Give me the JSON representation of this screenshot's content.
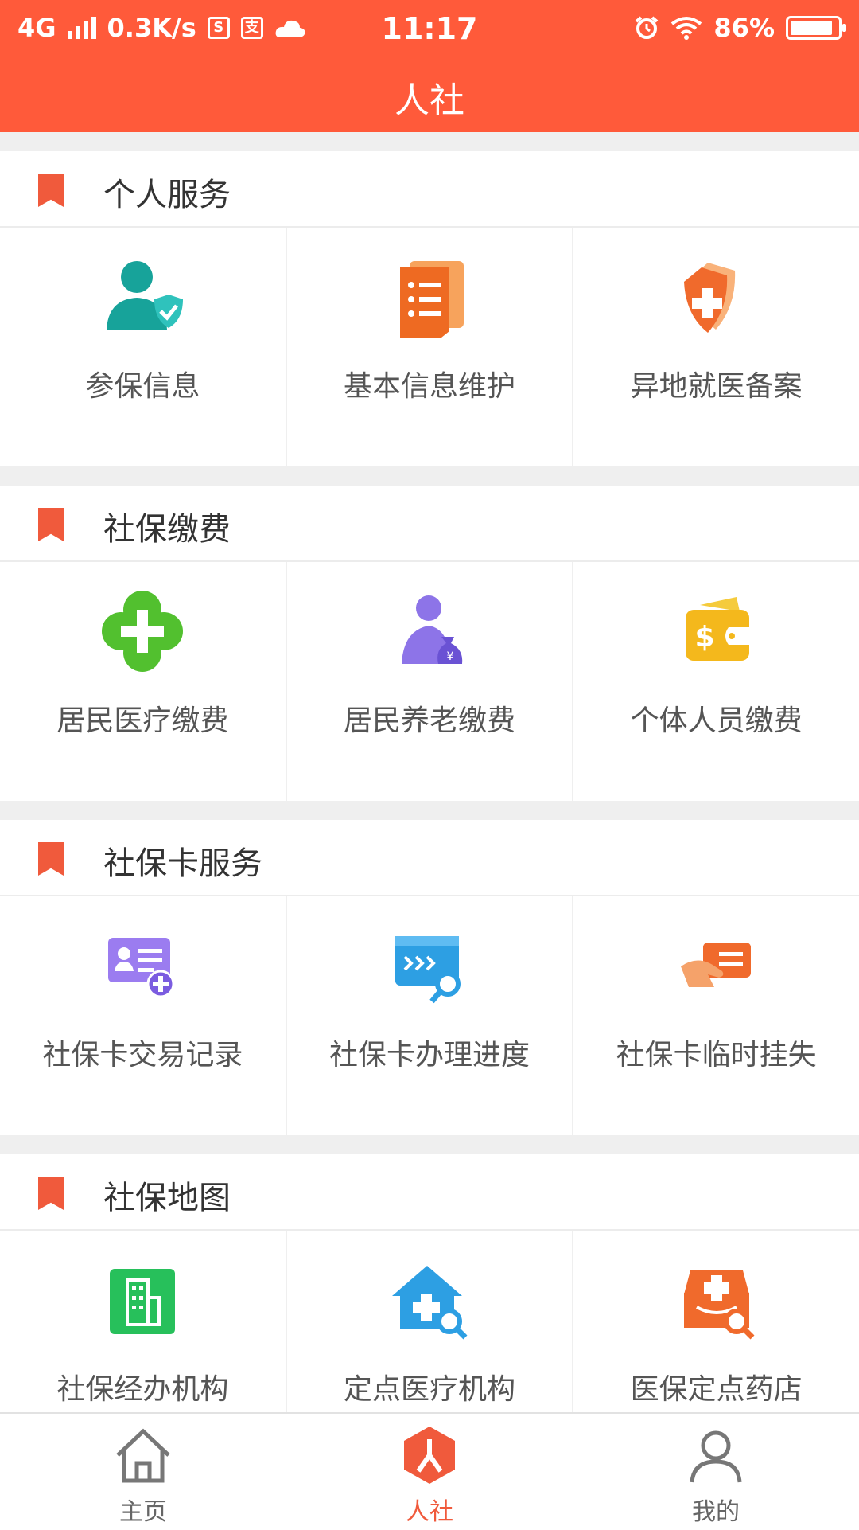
{
  "status_bar": {
    "network": "4G",
    "speed": "0.3K/s",
    "time": "11:17",
    "battery": "86%"
  },
  "header": {
    "title": "人社"
  },
  "sections": [
    {
      "title": "个人服务",
      "items": [
        {
          "label": "参保信息",
          "icon": "person-shield-icon"
        },
        {
          "label": "基本信息维护",
          "icon": "document-list-icon"
        },
        {
          "label": "异地就医备案",
          "icon": "medical-shield-icon"
        }
      ]
    },
    {
      "title": "社保缴费",
      "items": [
        {
          "label": "居民医疗缴费",
          "icon": "green-cross-icon"
        },
        {
          "label": "居民养老缴费",
          "icon": "elder-money-bag-icon"
        },
        {
          "label": "个体人员缴费",
          "icon": "wallet-icon"
        }
      ]
    },
    {
      "title": "社保卡服务",
      "items": [
        {
          "label": "社保卡交易记录",
          "icon": "card-add-icon"
        },
        {
          "label": "社保卡办理进度",
          "icon": "card-search-icon"
        },
        {
          "label": "社保卡临时挂失",
          "icon": "hand-card-icon"
        }
      ]
    },
    {
      "title": "社保地图",
      "items": [
        {
          "label": "社保经办机构",
          "icon": "building-icon"
        },
        {
          "label": "定点医疗机构",
          "icon": "hospital-search-icon"
        },
        {
          "label": "医保定点药店",
          "icon": "pharmacy-search-icon"
        }
      ]
    }
  ],
  "bottom_nav": [
    {
      "label": "主页",
      "icon": "home-icon",
      "active": false
    },
    {
      "label": "人社",
      "icon": "renshe-icon",
      "active": true
    },
    {
      "label": "我的",
      "icon": "user-icon",
      "active": false
    }
  ],
  "colors": {
    "accent": "#ff5a3a",
    "background": "#efefef"
  }
}
